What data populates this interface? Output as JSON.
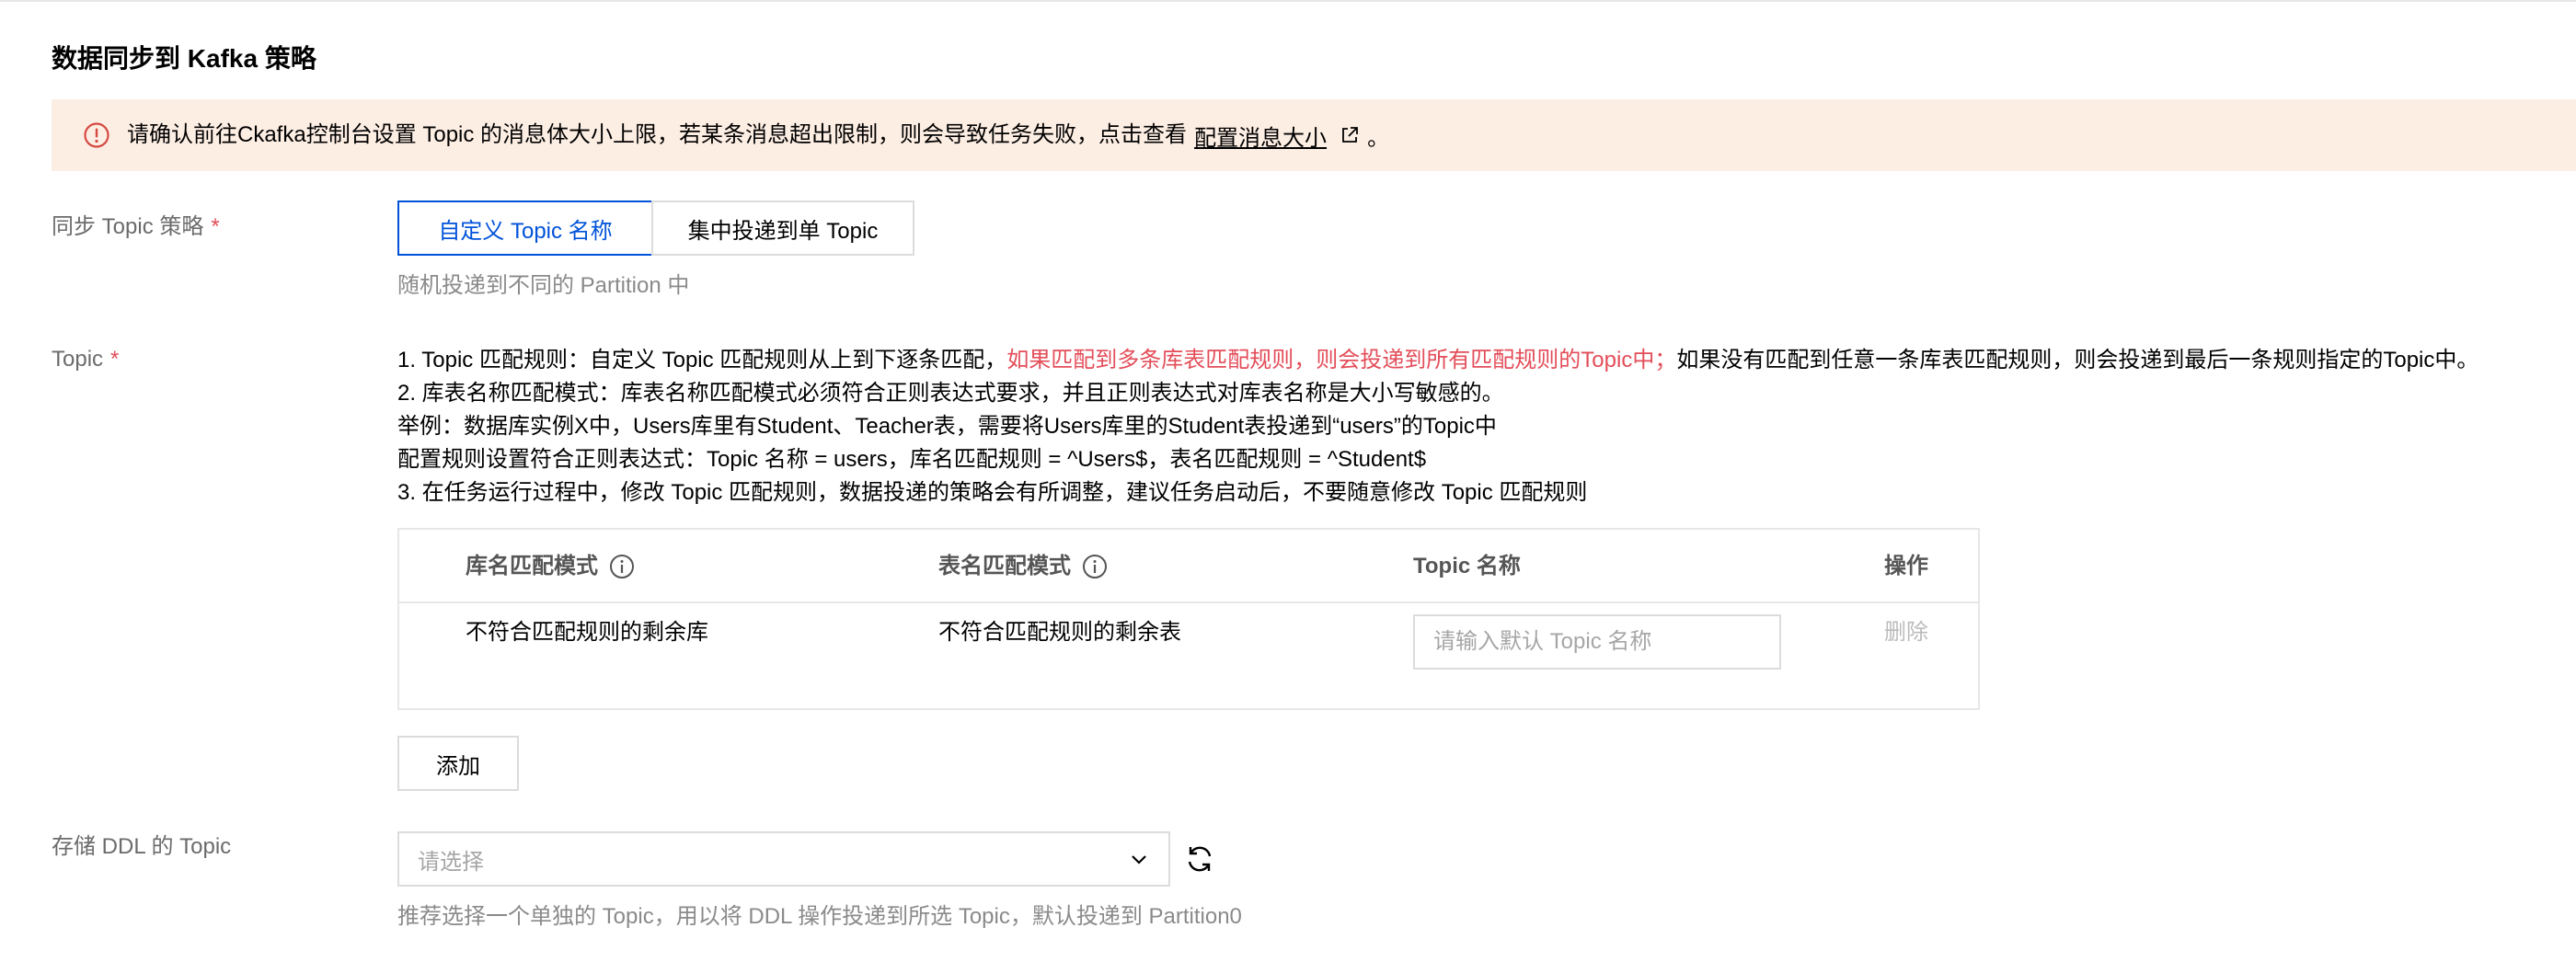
{
  "section": {
    "title": "数据同步到 Kafka 策略"
  },
  "alert": {
    "text": "请确认前往Ckafka控制台设置 Topic 的消息体大小上限，若某条消息超出限制，则会导致任务失败，点击查看",
    "link": "配置消息大小",
    "tail": "。",
    "colors": {
      "background": "#fdeee4",
      "icon": "#d54941"
    }
  },
  "sync_strategy": {
    "label": "同步 Topic 策略",
    "required_mark": "*",
    "options": [
      "自定义 Topic 名称",
      "集中投递到单 Topic"
    ],
    "selected": "自定义 Topic 名称",
    "hint": "随机投递到不同的 Partition 中"
  },
  "topic": {
    "label": "Topic",
    "required_mark": "*",
    "rules": {
      "line1_prefix": "1. Topic 匹配规则：自定义 Topic 匹配规则从上到下逐条匹配，",
      "line1_red": "如果匹配到多条库表匹配规则，则会投递到所有匹配规则的Topic中；",
      "line1_suffix": "如果没有匹配到任意一条库表匹配规则，则会投递到最后一条规则指定的Topic中。",
      "line2": "2. 库表名称匹配模式：库表名称匹配模式必须符合正则表达式要求，并且正则表达式对库表名称是大小写敏感的。",
      "line3": "举例：数据库实例X中，Users库里有Student、Teacher表，需要将Users库里的Student表投递到“users”的Topic中",
      "line4": "配置规则设置符合正则表达式：Topic 名称 = users，库名匹配规则 = ^Users$，表名匹配规则 = ^Student$",
      "line5": "3. 在任务运行过程中，修改 Topic 匹配规则，数据投递的策略会有所调整，建议任务启动后，不要随意修改 Topic 匹配规则"
    },
    "table": {
      "headers": {
        "db": "库名匹配模式",
        "table": "表名匹配模式",
        "topic": "Topic 名称",
        "op": "操作"
      },
      "rows": [
        {
          "db": "不符合匹配规则的剩余库",
          "table": "不符合匹配规则的剩余表",
          "topic_placeholder": "请输入默认 Topic 名称",
          "op": "删除"
        }
      ]
    },
    "add_label": "添加"
  },
  "ddl": {
    "label": "存储 DDL 的 Topic",
    "placeholder": "请选择",
    "hint": "推荐选择一个单独的 Topic，用以将 DDL 操作投递到所选 Topic，默认投递到 Partition0"
  },
  "colors": {
    "accent": "#0052d9",
    "required": "#e34d59"
  }
}
